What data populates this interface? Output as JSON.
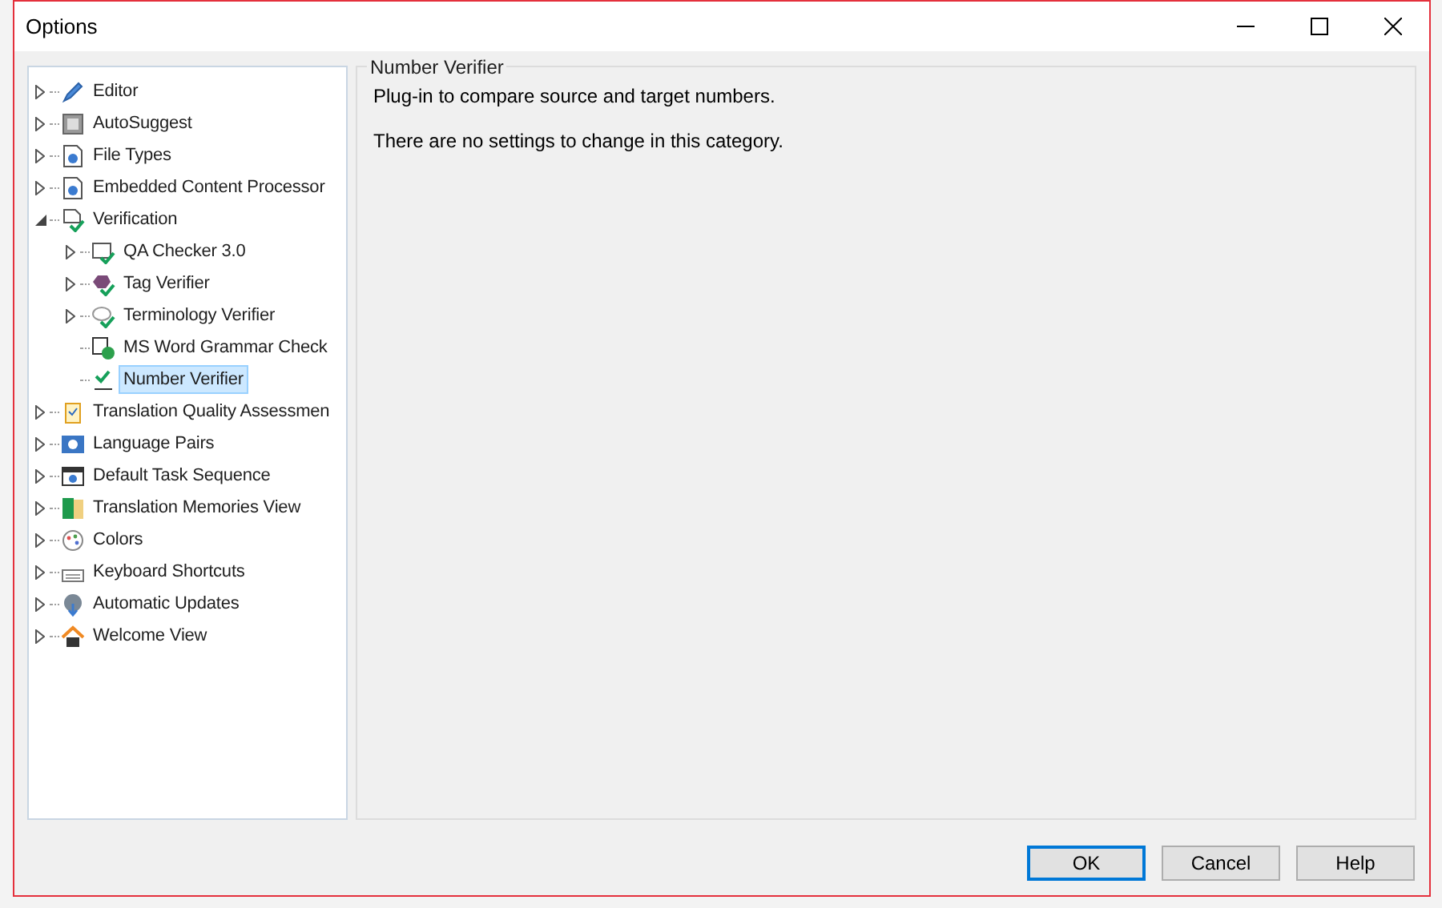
{
  "window": {
    "title": "Options"
  },
  "tree": {
    "items": [
      {
        "label": "Editor",
        "kind": "branch",
        "expanded": false,
        "selected": false
      },
      {
        "label": "AutoSuggest",
        "kind": "branch",
        "expanded": false,
        "selected": false
      },
      {
        "label": "File Types",
        "kind": "branch",
        "expanded": false,
        "selected": false
      },
      {
        "label": "Embedded Content Processor",
        "kind": "branch",
        "expanded": false,
        "selected": false
      },
      {
        "label": "Verification",
        "kind": "branch",
        "expanded": true,
        "selected": false,
        "children": [
          {
            "label": "QA Checker 3.0",
            "kind": "branch",
            "expanded": false,
            "selected": false
          },
          {
            "label": "Tag Verifier",
            "kind": "branch",
            "expanded": false,
            "selected": false
          },
          {
            "label": "Terminology Verifier",
            "kind": "branch",
            "expanded": false,
            "selected": false
          },
          {
            "label": "MS Word Grammar Check",
            "kind": "leaf",
            "selected": false
          },
          {
            "label": "Number Verifier",
            "kind": "leaf",
            "selected": true
          }
        ]
      },
      {
        "label": "Translation Quality Assessmen",
        "kind": "branch",
        "expanded": false,
        "selected": false
      },
      {
        "label": "Language Pairs",
        "kind": "branch",
        "expanded": false,
        "selected": false
      },
      {
        "label": "Default Task Sequence",
        "kind": "branch",
        "expanded": false,
        "selected": false
      },
      {
        "label": "Translation Memories View",
        "kind": "branch",
        "expanded": false,
        "selected": false
      },
      {
        "label": "Colors",
        "kind": "branch",
        "expanded": false,
        "selected": false
      },
      {
        "label": "Keyboard Shortcuts",
        "kind": "branch",
        "expanded": false,
        "selected": false
      },
      {
        "label": "Automatic Updates",
        "kind": "branch",
        "expanded": false,
        "selected": false
      },
      {
        "label": "Welcome View",
        "kind": "branch",
        "expanded": false,
        "selected": false
      }
    ]
  },
  "panel": {
    "title": "Number Verifier",
    "paragraphs": [
      "Plug-in to compare source and target numbers.",
      "There are no settings to change in this category."
    ]
  },
  "buttons": [
    {
      "label": "OK",
      "default": true
    },
    {
      "label": "Cancel",
      "default": false
    },
    {
      "label": "Help",
      "default": false
    }
  ]
}
